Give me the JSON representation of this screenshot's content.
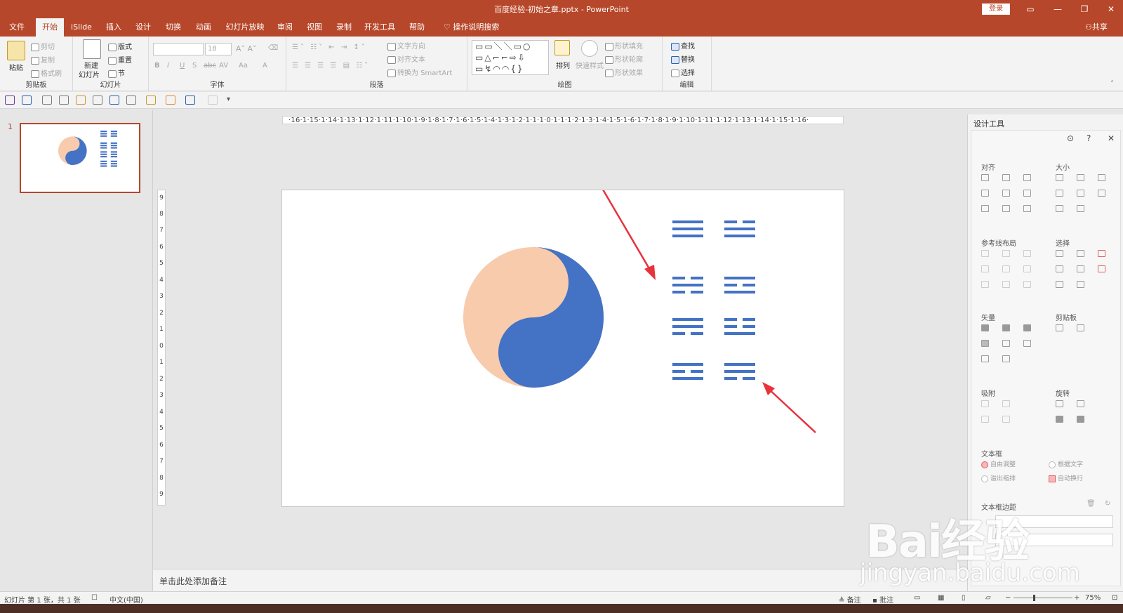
{
  "titlebar": {
    "title": "百度经验-初始之章.pptx  -  PowerPoint",
    "login": "登录"
  },
  "tabs": [
    "文件",
    "开始",
    "iSlide",
    "插入",
    "设计",
    "切换",
    "动画",
    "幻灯片放映",
    "审阅",
    "视图",
    "录制",
    "开发工具",
    "帮助"
  ],
  "active_tab": "开始",
  "tell_me": "操作说明搜索",
  "share": "共享",
  "ribbon": {
    "clipboard": {
      "label": "剪贴板",
      "paste": "粘贴",
      "cut": "剪切",
      "copy": "复制",
      "format_painter": "格式刷"
    },
    "slides": {
      "label": "幻灯片",
      "new_slide_line1": "新建",
      "new_slide_line2": "幻灯片",
      "layout": "版式",
      "reset": "重置",
      "section": "节"
    },
    "font": {
      "label": "字体",
      "size": "18",
      "buttons": [
        "B",
        "I",
        "U",
        "S",
        "abc",
        "AV",
        "Aa",
        "A"
      ]
    },
    "paragraph": {
      "label": "段落",
      "text_direction": "文字方向",
      "align_text": "对齐文本",
      "smartart": "转换为 SmartArt"
    },
    "drawing": {
      "label": "绘图",
      "arrange": "排列",
      "quick_styles": "快速样式",
      "shape_fill": "形状填充",
      "shape_outline": "形状轮廓",
      "shape_effects": "形状效果"
    },
    "editing": {
      "label": "编辑",
      "find": "查找",
      "replace": "替换",
      "select": "选择"
    }
  },
  "thumbnail": {
    "number": "1"
  },
  "ruler_h": "·16·1·15·1·14·1·13·1·12·1·11·1·10·1·9·1·8·1·7·1·6·1·5·1·4·1·3·1·2·1·1·1·0·1·1·1·2·1·3·1·4·1·5·1·6·1·7·1·8·1·9·1·10·1·11·1·12·1·13·1·14·1·15·1·16·",
  "ruler_v": [
    "9",
    "8",
    "7",
    "6",
    "5",
    "4",
    "3",
    "2",
    "1",
    "0",
    "1",
    "2",
    "3",
    "4",
    "5",
    "6",
    "7",
    "8",
    "9"
  ],
  "notes_placeholder": "单击此处添加备注",
  "design_panel": {
    "title": "设计工具",
    "sections": {
      "align": "对齐",
      "size": "大小",
      "guides": "参考线布局",
      "select": "选择",
      "vector": "矢量",
      "clipboard": "剪贴板",
      "snap": "吸附",
      "rotate": "旋转",
      "textbox": "文本框",
      "textbox_margin": "文本框边距"
    },
    "textbox_options": {
      "autofit": "自由调整",
      "by_text": "根据文字",
      "overflow": "溢出缩排",
      "wrap": "自动换行"
    }
  },
  "status": {
    "slide_info": "幻灯片 第 1 张，共 1 张",
    "language": "中文(中国)",
    "notes": "备注",
    "comments": "批注",
    "zoom": "75%"
  },
  "slide": {
    "yin_color": "#f7cbac",
    "yang_color": "#4472c4",
    "trigram_color": "#4472c4",
    "arrow_color": "#e8323c"
  },
  "watermark": {
    "brand": "Bai经验",
    "url": "jingyan.baidu.com"
  },
  "colors": {
    "accent": "#b7472a"
  }
}
